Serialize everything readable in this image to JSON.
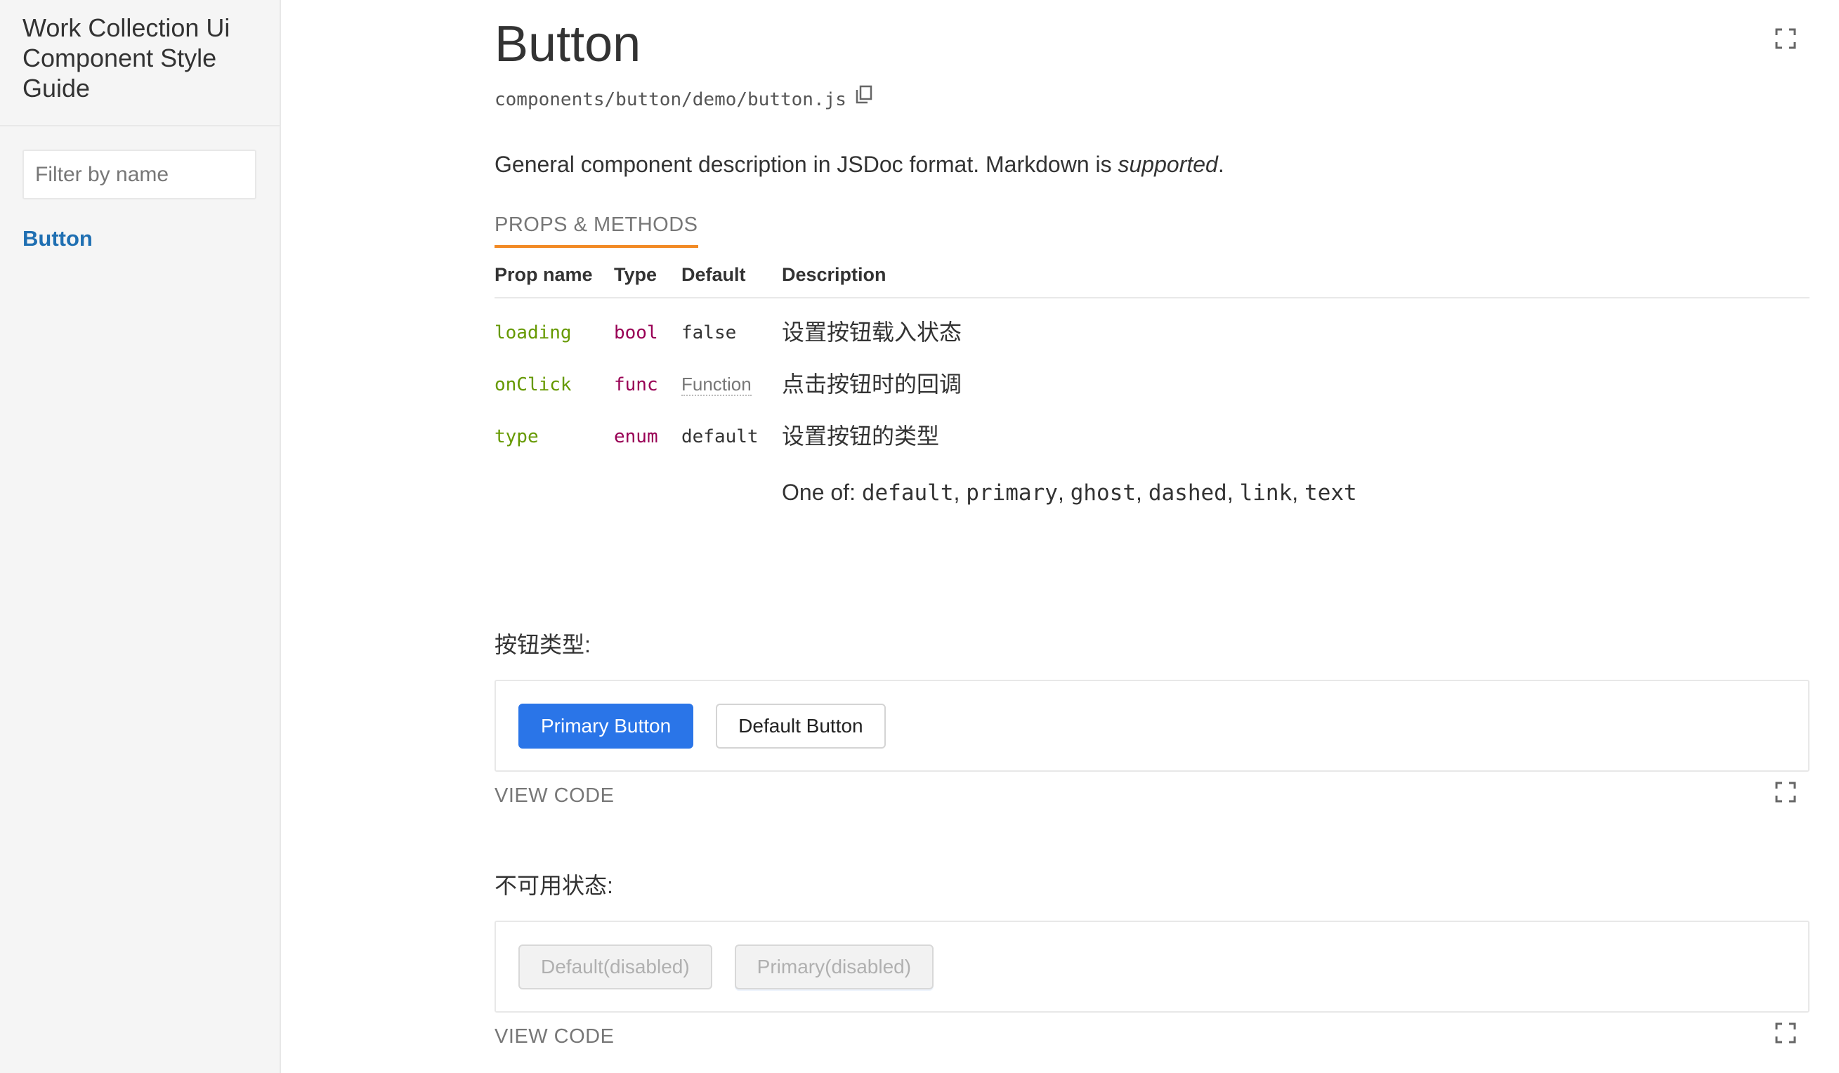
{
  "sidebar": {
    "title": "Work Collection Ui Component Style Guide",
    "filter_placeholder": "Filter by name",
    "items": [
      {
        "label": "Button"
      }
    ]
  },
  "component": {
    "title": "Button",
    "path": "components/button/demo/button.js",
    "description_prefix": "General component description in JSDoc format. Markdown is ",
    "description_emphasis": "supported",
    "description_suffix": ".",
    "props_tab": "PROPS & METHODS"
  },
  "props_table": {
    "headers": [
      "Prop name",
      "Type",
      "Default",
      "Description"
    ],
    "rows": [
      {
        "name": "loading",
        "type": "bool",
        "default": "false",
        "description": "设置按钮载入状态"
      },
      {
        "name": "onClick",
        "type": "func",
        "default": "Function",
        "description": "点击按钮时的回调"
      },
      {
        "name": "type",
        "type": "enum",
        "default": "default",
        "description": "设置按钮的类型"
      }
    ],
    "one_of_label": "One of: ",
    "one_of_values": [
      "default",
      "primary",
      "ghost",
      "dashed",
      "link",
      "text"
    ]
  },
  "examples": [
    {
      "heading": "按钮类型:",
      "buttons": [
        "Primary Button",
        "Default Button"
      ],
      "view_code": "VIEW CODE"
    },
    {
      "heading": "不可用状态:",
      "buttons": [
        "Default(disabled)",
        "Primary(disabled)"
      ],
      "view_code": "VIEW CODE"
    }
  ],
  "colors": {
    "primary": "#2a75e8",
    "link": "#1f6fb2",
    "tab_underline": "#f28a24",
    "prop_name": "#669900",
    "prop_type": "#990055"
  },
  "icons": [
    "fullscreen-icon",
    "copy-icon"
  ]
}
